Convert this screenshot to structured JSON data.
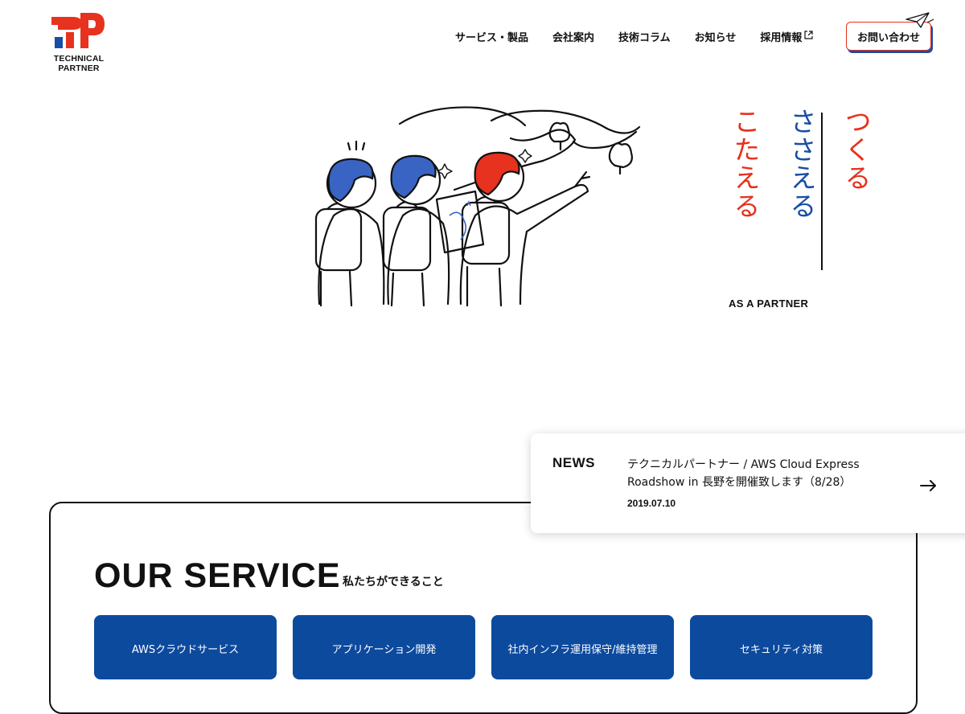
{
  "header": {
    "logo_text": "TECHNICAL PARTNER",
    "nav": [
      {
        "label": "サービス・製品"
      },
      {
        "label": "会社案内"
      },
      {
        "label": "技術コラム"
      },
      {
        "label": "お知らせ"
      },
      {
        "label": "採用情報",
        "icon": "external-link-icon"
      }
    ],
    "contact_label": "お問い合わせ"
  },
  "hero": {
    "columns": [
      "つくる",
      "ささえる",
      "こたえる"
    ],
    "tagline": "AS A PARTNER"
  },
  "news": {
    "label": "NEWS",
    "title": "テクニカルパートナー / AWS Cloud Express Roadshow in 長野を開催致します（8/28）",
    "date": "2019.07.10"
  },
  "service": {
    "title": "OUR SERVICE",
    "subtitle": "私たちができること",
    "cards": [
      {
        "label": "AWSクラウドサービス"
      },
      {
        "label": "アプリケーション開発"
      },
      {
        "label": "社内インフラ運用保守/維持管理"
      },
      {
        "label": "セキュリティ対策"
      }
    ]
  },
  "colors": {
    "red": "#e6321e",
    "blue": "#174ea6",
    "card_blue": "#0c4a9e"
  }
}
